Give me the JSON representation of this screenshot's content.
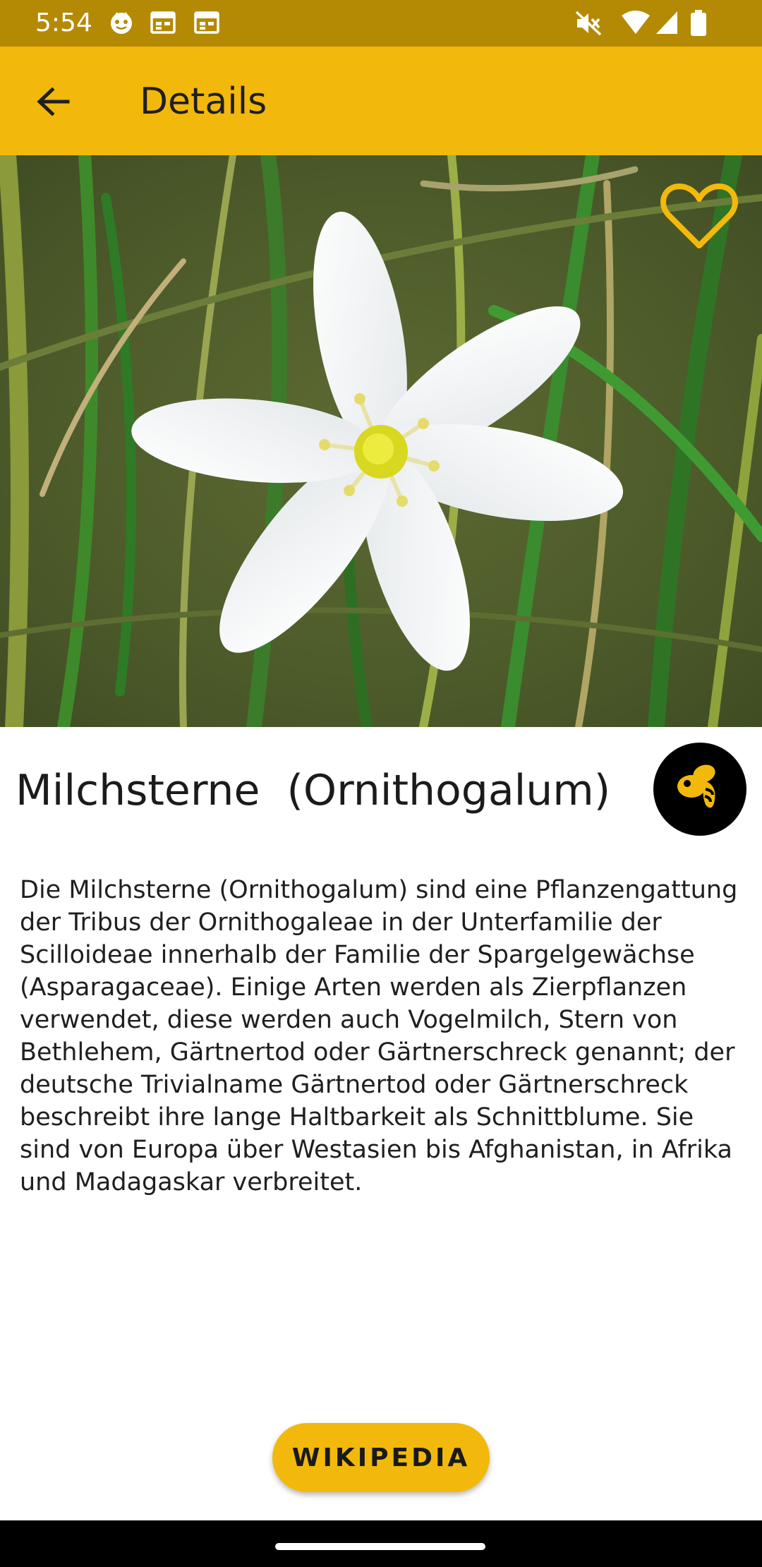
{
  "status_bar": {
    "time": "5:54",
    "background": "#b48a04",
    "icons": [
      "face-icon",
      "calendar-icon",
      "calendar-icon",
      "mute-icon",
      "wifi-icon",
      "signal-icon",
      "battery-icon"
    ]
  },
  "app_bar": {
    "title": "Details",
    "background": "#f2b90c",
    "back_icon": "arrow-left-icon"
  },
  "hero": {
    "favorite_icon": "heart-outline-icon",
    "favorite_color": "#f2b90c"
  },
  "plant": {
    "title": "Milchsterne  (Ornithogalum)",
    "description": "Die Milchsterne (Ornithogalum) sind eine Pflanzengattung der Tribus der Ornithogaleae in der Unterfamilie der Scilloideae innerhalb der Familie der Spargelgewächse (Asparagaceae). Einige Arten werden als Zierpflanzen verwendet, diese werden auch Vogelmilch, Stern von Bethlehem, Gärtnertod oder Gärtnerschreck genannt; der deutsche Trivialname Gärtnertod oder Gärtnerschreck beschreibt ihre lange Haltbarkeit als Schnittblume. Sie sind von Europa über Westasien bis Afghanistan, in Afrika und Madagaskar verbreitet.",
    "bee_icon": "bee-icon"
  },
  "actions": {
    "wikipedia_label": "WIKIPEDIA"
  }
}
